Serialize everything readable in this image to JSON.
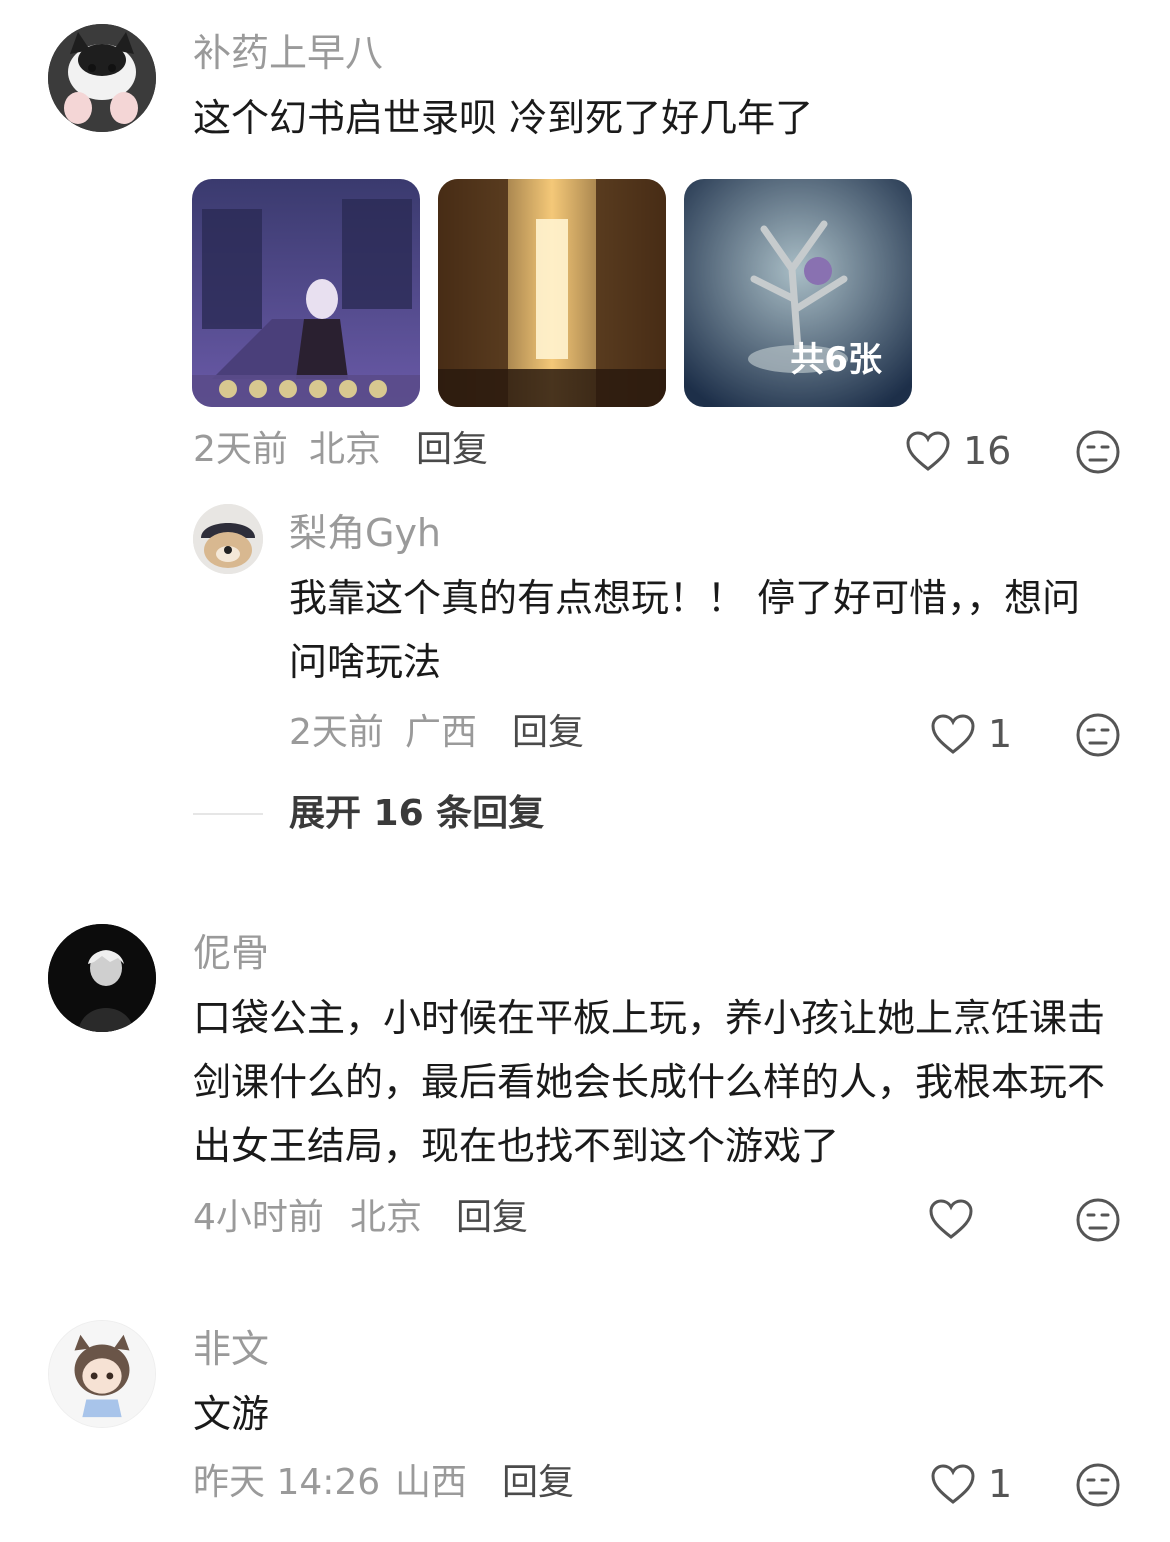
{
  "comments": [
    {
      "username": "补药上早八",
      "text": "这个幻书启世录呗 冷到死了好几年了",
      "images_more_label": "共6张",
      "time": "2天前",
      "location": "北京",
      "reply_label": "回复",
      "likes": "16",
      "replies": [
        {
          "username": "梨角Gyh",
          "text": "我靠这个真的有点想玩！！ 停了好可惜，，想问问啥玩法",
          "time": "2天前",
          "location": "广西",
          "reply_label": "回复",
          "likes": "1"
        }
      ],
      "expand_label": "展开 16 条回复"
    },
    {
      "username": "伲骨",
      "text": "口袋公主，小时候在平板上玩，养小孩让她上烹饪课击剑课什么的，最后看她会长成什么样的人，我根本玩不出女王结局，现在也找不到这个游戏了",
      "time": "4小时前",
      "location": "北京",
      "reply_label": "回复",
      "likes": ""
    },
    {
      "username": "非文",
      "text": "文游",
      "time": "昨天 14:26",
      "location": "山西",
      "reply_label": "回复",
      "likes": "1"
    }
  ],
  "icons": {
    "like": "heart-outline-icon",
    "dislike": "neutral-face-icon"
  },
  "colors": {
    "username": "#9a9a9a",
    "text": "#1a1a1a",
    "meta": "#9a9a9a"
  }
}
